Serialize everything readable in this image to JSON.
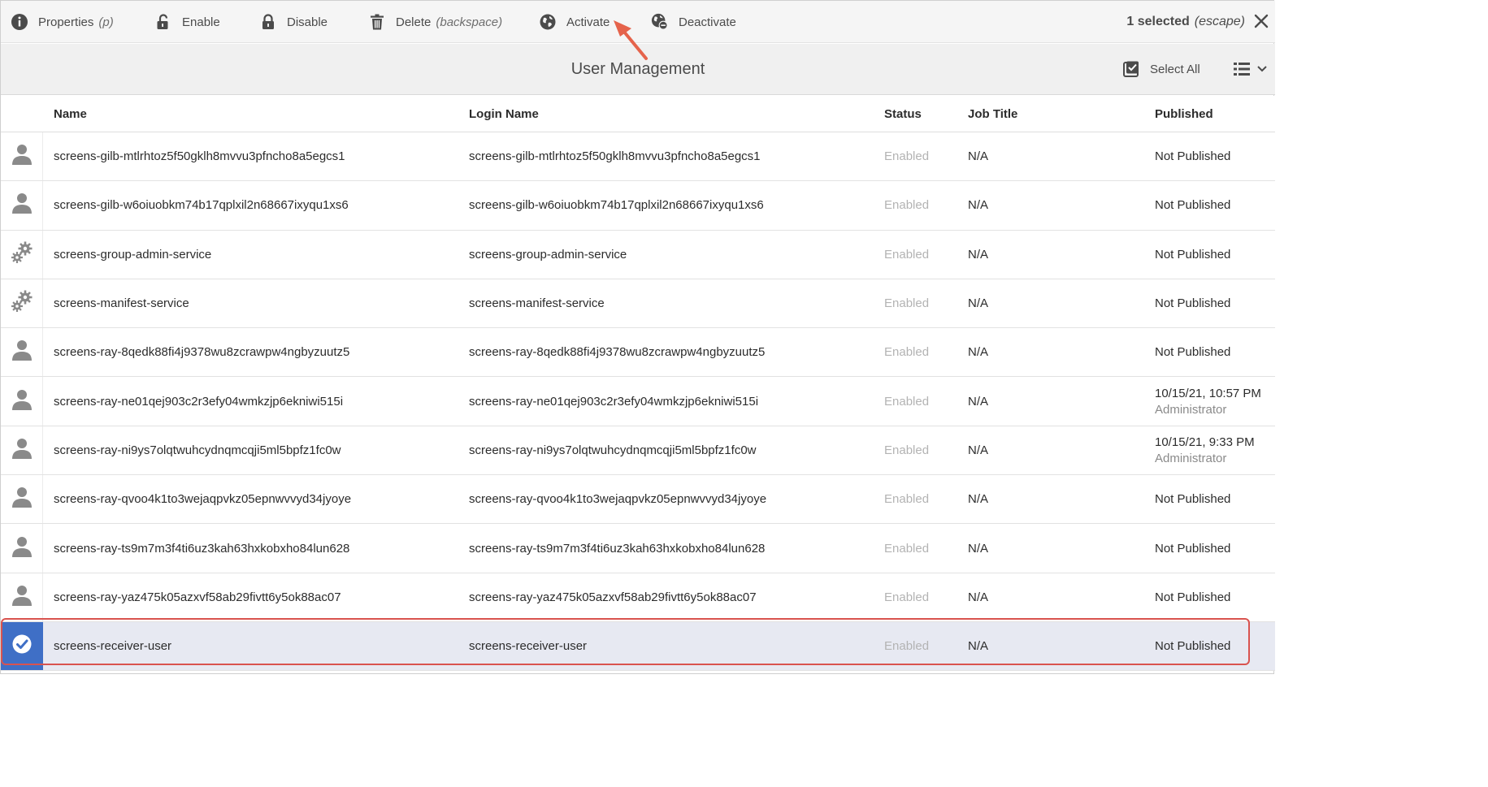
{
  "action_bar": {
    "properties": {
      "label": "Properties",
      "hint": "(p)",
      "icon": "info-icon"
    },
    "enable": {
      "label": "Enable",
      "icon": "unlock-icon"
    },
    "disable": {
      "label": "Disable",
      "icon": "lock-icon"
    },
    "delete": {
      "label": "Delete",
      "hint": "(backspace)",
      "icon": "trash-icon"
    },
    "activate": {
      "label": "Activate",
      "icon": "globe-icon"
    },
    "deactivate": {
      "label": "Deactivate",
      "icon": "globe-minus-icon"
    },
    "selection": {
      "count_label": "1 selected",
      "hint": "(escape)"
    },
    "close_icon": "close-icon"
  },
  "title_bar": {
    "title": "User Management",
    "select_all_label": "Select All",
    "select_all_icon": "checkbox-icon",
    "view_icon": "list-view-icon"
  },
  "table": {
    "columns": {
      "name": "Name",
      "login": "Login Name",
      "status": "Status",
      "job": "Job Title",
      "published": "Published"
    },
    "rows": [
      {
        "icon": "user-icon",
        "name": "screens-gilb-mtlrhtoz5f50gklh8mvvu3pfncho8a5egcs1",
        "login": "screens-gilb-mtlrhtoz5f50gklh8mvvu3pfncho8a5egcs1",
        "status": "Enabled",
        "job": "N/A",
        "published": "Not Published",
        "published_by": ""
      },
      {
        "icon": "user-icon",
        "name": "screens-gilb-w6oiuobkm74b17qplxil2n68667ixyqu1xs6",
        "login": "screens-gilb-w6oiuobkm74b17qplxil2n68667ixyqu1xs6",
        "status": "Enabled",
        "job": "N/A",
        "published": "Not Published",
        "published_by": ""
      },
      {
        "icon": "gears-icon",
        "name": "screens-group-admin-service",
        "login": "screens-group-admin-service",
        "status": "Enabled",
        "job": "N/A",
        "published": "Not Published",
        "published_by": ""
      },
      {
        "icon": "gears-icon",
        "name": "screens-manifest-service",
        "login": "screens-manifest-service",
        "status": "Enabled",
        "job": "N/A",
        "published": "Not Published",
        "published_by": ""
      },
      {
        "icon": "user-icon",
        "name": "screens-ray-8qedk88fi4j9378wu8zcrawpw4ngbyzuutz5",
        "login": "screens-ray-8qedk88fi4j9378wu8zcrawpw4ngbyzuutz5",
        "status": "Enabled",
        "job": "N/A",
        "published": "Not Published",
        "published_by": ""
      },
      {
        "icon": "user-icon",
        "name": "screens-ray-ne01qej903c2r3efy04wmkzjp6ekniwi515i",
        "login": "screens-ray-ne01qej903c2r3efy04wmkzjp6ekniwi515i",
        "status": "Enabled",
        "job": "N/A",
        "published": "10/15/21, 10:57 PM",
        "published_by": "Administrator"
      },
      {
        "icon": "user-icon",
        "name": "screens-ray-ni9ys7olqtwuhcydnqmcqji5ml5bpfz1fc0w",
        "login": "screens-ray-ni9ys7olqtwuhcydnqmcqji5ml5bpfz1fc0w",
        "status": "Enabled",
        "job": "N/A",
        "published": "10/15/21, 9:33 PM",
        "published_by": "Administrator"
      },
      {
        "icon": "user-icon",
        "name": "screens-ray-qvoo4k1to3wejaqpvkz05epnwvvyd34jyoye",
        "login": "screens-ray-qvoo4k1to3wejaqpvkz05epnwvvyd34jyoye",
        "status": "Enabled",
        "job": "N/A",
        "published": "Not Published",
        "published_by": ""
      },
      {
        "icon": "user-icon",
        "name": "screens-ray-ts9m7m3f4ti6uz3kah63hxkobxho84lun628",
        "login": "screens-ray-ts9m7m3f4ti6uz3kah63hxkobxho84lun628",
        "status": "Enabled",
        "job": "N/A",
        "published": "Not Published",
        "published_by": ""
      },
      {
        "icon": "user-icon",
        "name": "screens-ray-yaz475k05azxvf58ab29fivtt6y5ok88ac07",
        "login": "screens-ray-yaz475k05azxvf58ab29fivtt6y5ok88ac07",
        "status": "Enabled",
        "job": "N/A",
        "published": "Not Published",
        "published_by": ""
      },
      {
        "icon": "check-circle-icon",
        "name": "screens-receiver-user",
        "login": "screens-receiver-user",
        "status": "Enabled",
        "job": "N/A",
        "published": "Not Published",
        "published_by": "",
        "selected": true
      }
    ]
  },
  "colors": {
    "selection_accent": "#3f6fc6",
    "selected_row_bg": "#e7e9f2",
    "annotation_red": "#d9534f",
    "status_disabled_text": "#b3b3b3"
  }
}
